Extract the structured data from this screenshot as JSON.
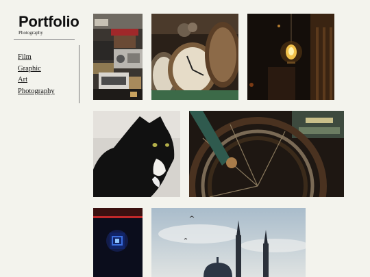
{
  "site": {
    "title": "Portfolio",
    "subtitle": "Photography"
  },
  "nav": {
    "items": [
      "Film",
      "Graphic",
      "Art",
      "Photography"
    ]
  },
  "gallery": {
    "items": [
      {
        "subject": "vintage-radios"
      },
      {
        "subject": "alarm-clocks"
      },
      {
        "subject": "hanging-lightbulb"
      },
      {
        "subject": "black-and-white-cat"
      },
      {
        "subject": "bicycle-wheel"
      },
      {
        "subject": "neon-sign-at-night"
      },
      {
        "subject": "mosque-skyline"
      }
    ]
  }
}
